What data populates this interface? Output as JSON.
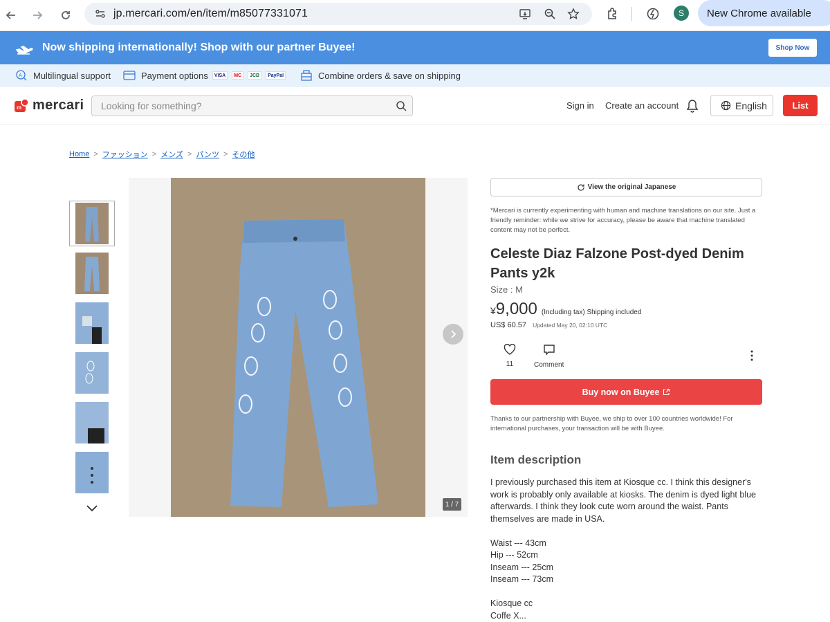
{
  "browser": {
    "url": "jp.mercari.com/en/item/m85077331071",
    "profile_initial": "S",
    "update_label": "New Chrome available"
  },
  "banner": {
    "text": "Now shipping internationally! Shop with our partner Buyee!",
    "button": "Shop Now"
  },
  "features": [
    {
      "label": "Multilingual support"
    },
    {
      "label": "Payment options"
    },
    {
      "label": "Combine orders & save on shipping"
    }
  ],
  "payment_logos": [
    "VISA",
    "MC",
    "JCB",
    "PayPal"
  ],
  "header": {
    "logo": "mercari",
    "search_placeholder": "Looking for something?",
    "sign_in": "Sign in",
    "create_account": "Create an account",
    "language": "English",
    "list_button": "List"
  },
  "breadcrumb": [
    "Home",
    "ファッション",
    "メンズ",
    "パンツ",
    "その他"
  ],
  "gallery": {
    "counter": "1 / 7"
  },
  "product": {
    "view_original": "View the original Japanese",
    "disclaimer": "*Mercari is currently experimenting with human and machine translations on our site. Just a friendly reminder: while we strive for accuracy, please be aware that machine translated content may not be perfect.",
    "title": "Celeste Diaz Falzone Post-dyed Denim Pants y2k",
    "size": "Size : M",
    "currency_symbol": "¥",
    "price": "9,000",
    "price_note": "(Including tax) Shipping included",
    "usd_prefix": "US$",
    "usd_price": "60.57",
    "updated": "Updated May 20, 02:10 UTC",
    "likes": "11",
    "comment_label": "Comment",
    "buy_button": "Buy now on Buyee",
    "partner_note": "Thanks to our partnership with Buyee, we ship to over 100 countries worldwide! For international purchases, your transaction will be with Buyee.",
    "description_heading": "Item description",
    "description": "I previously purchased this item at Kiosque cc. I think this designer's work is probably only available at kiosks. The denim is dyed light blue afterwards. I think they look cute worn around the waist. Pants themselves are made in USA.\n\nWaist --- 43cm\nHip --- 52cm\nInseam --- 25cm\nInseam --- 73cm\n\nKiosque cc\nCoffe X..."
  },
  "colors": {
    "banner_blue": "#4a8fe0",
    "mercari_red": "#ea352d",
    "buy_red": "#ea4444",
    "link_blue": "#0f5cc0"
  }
}
